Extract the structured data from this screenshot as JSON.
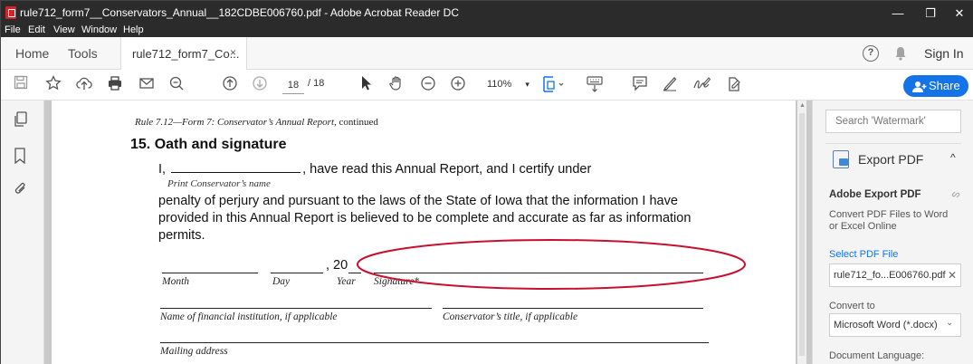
{
  "window": {
    "title": "rule712_form7__Conservators_Annual__182CDBE006760.pdf - Adobe Acrobat Reader DC",
    "minimize": "—",
    "maximize": "❐",
    "close": "✕"
  },
  "menu": [
    "File",
    "Edit",
    "View",
    "Window",
    "Help"
  ],
  "tabs": {
    "home": "Home",
    "tools": "Tools",
    "doc_tab": "rule712_form7_Co...",
    "close_tab": "×",
    "help": "?",
    "sign_in": "Sign In"
  },
  "toolbar": {
    "current_page": "18",
    "page_total": "/ 18",
    "zoom": "110%",
    "zoom_caret": "▾",
    "share_label": "Share",
    "icons": [
      "save-icon",
      "bookmark-star-icon",
      "upload-icon",
      "print-icon",
      "email-icon",
      "zoom-search-icon",
      "page-up-icon",
      "page-down-icon",
      "select-cursor-icon",
      "hand-icon",
      "zoom-out-icon",
      "zoom-in-icon",
      "fit-page-icon",
      "keyboard-scroll-icon",
      "comment-icon",
      "highlight-pen-icon",
      "sign-icon",
      "more-tools-icon"
    ]
  },
  "document": {
    "running_head_italic": "Rule 7.12—Form 7: Conservator’s Annual Report,",
    "running_head_plain": "continued",
    "heading": "15. Oath and signature",
    "oath_prefix": "I,",
    "oath_suffix": ", have read this Annual Report, and I certify under",
    "print_name_label": "Print Conservator’s name",
    "paragraph": "penalty of perjury and pursuant to the laws of the State of Iowa that the information I have provided in this Annual Report is believed to be complete and accurate as far as information permits.",
    "year_prefix": ", 20",
    "labels": {
      "month": "Month",
      "day": "Day",
      "year": "Year",
      "signature": "Signature*",
      "financial_institution": "Name of financial institution, if applicable",
      "conservator_title": "Conservator’s title, if applicable",
      "mailing_address": "Mailing address"
    }
  },
  "right_pane": {
    "search_placeholder": "Search 'Watermark'",
    "export_pdf": "Export PDF",
    "collapse": "^",
    "section_title": "Adobe Export PDF",
    "description": "Convert PDF Files to Word or Excel Online",
    "select_file": "Select PDF File",
    "file_name": "rule712_fo...E006760.pdf",
    "file_remove": "✕",
    "convert_to": "Convert to",
    "format": "Microsoft Word (*.docx)",
    "format_caret": "⌄",
    "document_language": "Document Language:"
  },
  "colors": {
    "annotation_circle": "#c8102e",
    "share_button": "#1473e6",
    "title_bar": "#2b2b2b"
  }
}
